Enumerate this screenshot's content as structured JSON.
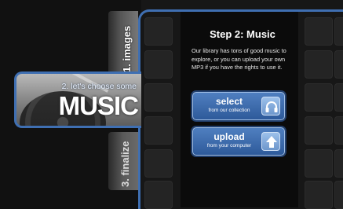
{
  "steps": {
    "images_tab": "1. images",
    "music_tab_small": "2. let's choose some",
    "music_tab_big": "MUSIC",
    "finalize_tab": "3. finalize"
  },
  "panel": {
    "title": "Step 2: Music",
    "description": "Our library has tons of good music to explore, or you can upload your own MP3 if you have the rights to use it."
  },
  "buttons": {
    "select_label": "select",
    "select_sub": "from our collection",
    "select_icon": "headphones-icon",
    "upload_label": "upload",
    "upload_sub": "from your computer",
    "upload_icon": "up-arrow-icon"
  },
  "colors": {
    "accent": "#3f6fb2",
    "button": "#4a7cc0",
    "background": "#171717"
  }
}
